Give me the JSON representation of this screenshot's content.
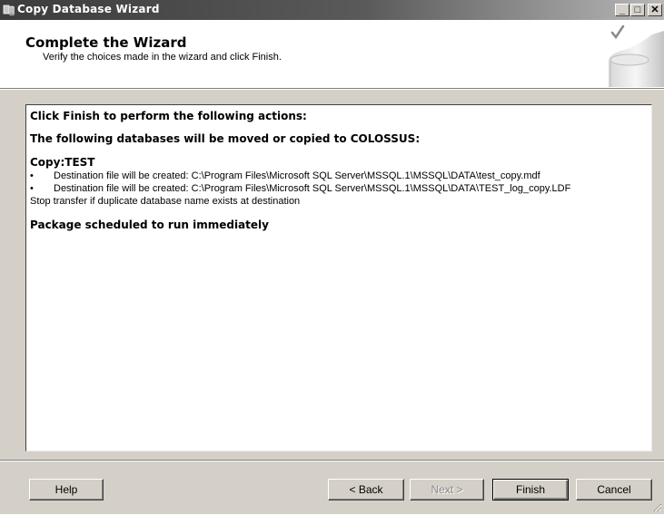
{
  "window": {
    "title": "Copy Database Wizard",
    "icon": "wizard-app-icon",
    "controls": {
      "minimize": "_",
      "maximize": "□",
      "close": "✕"
    }
  },
  "header": {
    "title": "Complete the Wizard",
    "subtitle": "Verify the choices made in the wizard and click Finish.",
    "art_icon": "checkmark-database-icon"
  },
  "summary": {
    "actions_heading": "Click Finish to perform the following actions:",
    "databases_heading": "The following databases will be moved or copied to COLOSSUS:",
    "copy_heading": "Copy:TEST",
    "bullet_char": "•",
    "bullets": [
      "Destination file will be created: C:\\Program Files\\Microsoft SQL Server\\MSSQL.1\\MSSQL\\DATA\\test_copy.mdf",
      "Destination file will be created: C:\\Program Files\\Microsoft SQL Server\\MSSQL.1\\MSSQL\\DATA\\TEST_log_copy.LDF"
    ],
    "stop_transfer": "Stop transfer if duplicate database name exists at destination",
    "package_line": "Package scheduled to run immediately"
  },
  "buttons": {
    "help": "Help",
    "back": "< Back",
    "next": "Next >",
    "finish": "Finish",
    "cancel": "Cancel"
  }
}
